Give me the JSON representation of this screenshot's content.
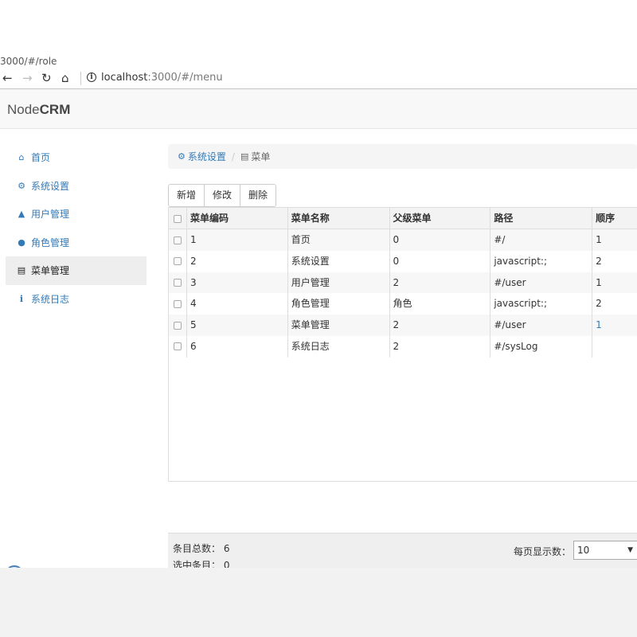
{
  "browser": {
    "tab_url": "3000/#/role",
    "address_host": "localhost",
    "address_path": ":3000/#/menu",
    "icons": [
      "back-arrow-icon",
      "forward-arrow-icon",
      "reload-icon",
      "home-icon",
      "info-icon"
    ]
  },
  "app": {
    "brand_light": "Node",
    "brand_bold": "CRM"
  },
  "sidebar": {
    "items": [
      {
        "label": "首页",
        "icon": "home-icon",
        "glyph": "⌂"
      },
      {
        "label": "系统设置",
        "icon": "gears-icon",
        "glyph": "⚙"
      },
      {
        "label": "用户管理",
        "icon": "user-icon",
        "glyph": "▲"
      },
      {
        "label": "角色管理",
        "icon": "users-icon",
        "glyph": "●"
      },
      {
        "label": "菜单管理",
        "icon": "list-alt-icon",
        "glyph": "▤",
        "active": true
      },
      {
        "label": "系统日志",
        "icon": "info-icon",
        "glyph": "i"
      }
    ]
  },
  "breadcrumb": {
    "parent": "系统设置",
    "current": "菜单"
  },
  "toolbar": {
    "add": "新增",
    "edit": "修改",
    "delete": "删除"
  },
  "grid": {
    "columns": [
      "菜单编码",
      "菜单名称",
      "父级菜单",
      "路径",
      "顺序"
    ],
    "rows": [
      [
        "1",
        "首页",
        "0",
        "#/",
        "1"
      ],
      [
        "2",
        "系统设置",
        "0",
        "javascript:;",
        "2"
      ],
      [
        "3",
        "用户管理",
        "2",
        "#/user",
        "1"
      ],
      [
        "4",
        "角色管理",
        "角色",
        "javascript:;",
        "2"
      ],
      [
        "5",
        "菜单管理",
        "2",
        "#/user",
        "1"
      ],
      [
        "6",
        "系统日志",
        "2",
        "#/sysLog",
        ""
      ]
    ]
  },
  "footer": {
    "total_label": "条目总数：",
    "total_value": "6",
    "selected_label": "选中条目：",
    "selected_value": "0",
    "page_size_label": "每页显示数：",
    "page_size_value": "10"
  }
}
